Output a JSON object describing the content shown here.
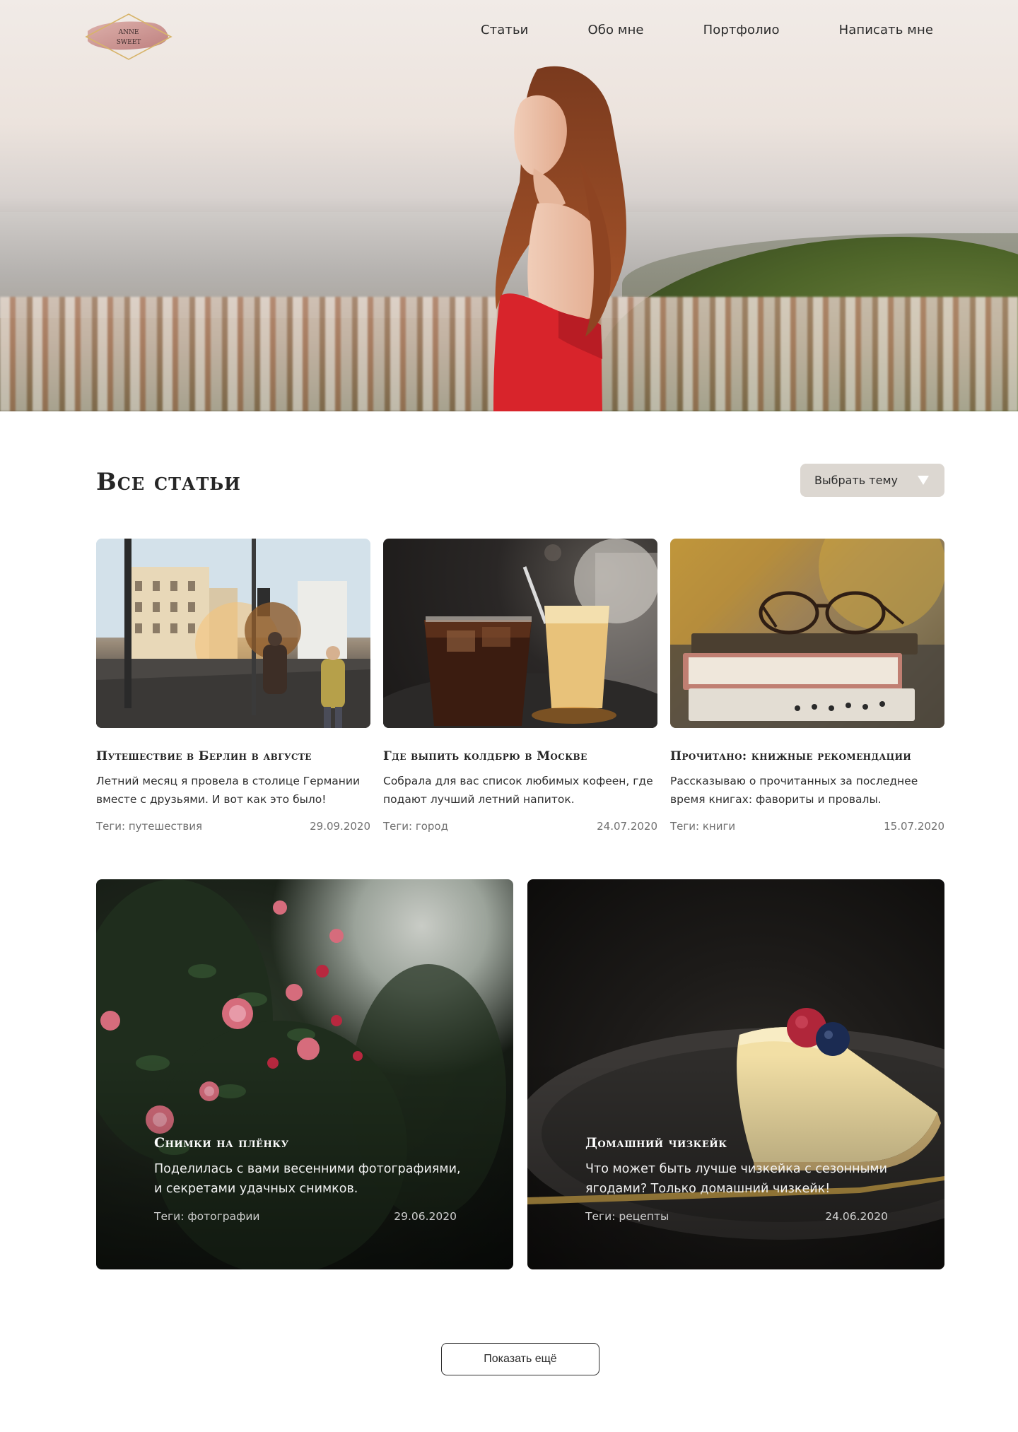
{
  "header": {
    "logo_text_line1": "ANNE",
    "logo_text_line2": "SWEET",
    "nav": [
      {
        "label": "Статьи"
      },
      {
        "label": "Обо мне"
      },
      {
        "label": "Портфолио"
      },
      {
        "label": "Написать мне"
      }
    ]
  },
  "main": {
    "title": "Все статьи",
    "topic_select": {
      "label": "Выбрать тему",
      "icon": "chevron-down-icon"
    },
    "cards": [
      {
        "title": "Путешествие в Берлин в августе",
        "description": "Летний месяц я провела в столице Германии вместе с друзьями. И вот как это было!",
        "tags": "Теги: путешествия",
        "date": "29.09.2020",
        "image": "berlin-street-photo"
      },
      {
        "title": "Где выпить колдбрю в Москве",
        "description": "Собрала для вас список любимых кофеен, где подают лучший летний напиток.",
        "tags": "Теги: город",
        "date": "24.07.2020",
        "image": "iced-coffee-photo"
      },
      {
        "title": "Прочитано: книжные рекомендации",
        "description": "Рассказываю о прочитанных за последнее время книгах: фавориты и провалы.",
        "tags": "Теги: книги",
        "date": "15.07.2020",
        "image": "books-glasses-photo"
      }
    ],
    "featured": [
      {
        "title": "Снимки на плёнку",
        "description": "Поделилась с вами весенними фотографиями, и секретами удачных снимков.",
        "tags": "Теги: фотографии",
        "date": "29.06.2020",
        "image": "flowers-photo"
      },
      {
        "title": "Домашний чизкейк",
        "description": "Что может быть лучше чизкейка с сезонными ягодами? Только домашний чизкейк!",
        "tags": "Теги: рецепты",
        "date": "24.06.2020",
        "image": "cheesecake-photo"
      }
    ],
    "show_more_label": "Показать ещё"
  },
  "colors": {
    "accent_select_bg": "#dcd7d1",
    "text_dark": "#2b2b2b",
    "text_muted": "#707070",
    "logo_gold": "#d7b46a",
    "logo_rose": "#c98b8b"
  }
}
